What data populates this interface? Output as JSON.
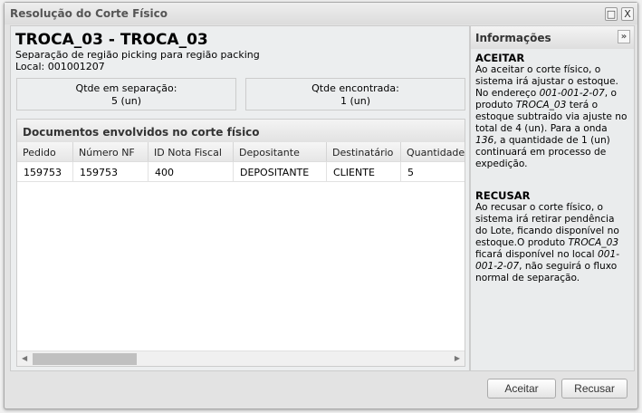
{
  "window": {
    "title": "Resolução do Corte Físico",
    "maximize_icon": "□",
    "close_icon": "X"
  },
  "header": {
    "title": "TROCA_03 - TROCA_03",
    "description": "Separação de região picking para região packing",
    "local": "Local: 001001207"
  },
  "stats": [
    {
      "label": "Qtde em separação:",
      "value": "5 (un)"
    },
    {
      "label": "Qtde encontrada:",
      "value": "1 (un)"
    }
  ],
  "grid": {
    "title": "Documentos envolvidos no corte físico",
    "columns": [
      "Pedido",
      "Número NF",
      "ID Nota Fiscal",
      "Depositante",
      "Destinatário",
      "Quantidade e"
    ],
    "rows": [
      [
        "159753",
        "159753",
        "400",
        "DEPOSITANTE",
        "CLIENTE",
        "5"
      ]
    ]
  },
  "info": {
    "title": "Informações",
    "collapse_icon": "»",
    "accept": {
      "heading": "ACEITAR",
      "segments": [
        {
          "t": "Ao aceitar o corte físico, o sistema irá ajustar o estoque. No endereço "
        },
        {
          "t": "001-001-2-07",
          "i": true
        },
        {
          "t": ", o produto "
        },
        {
          "t": "TROCA_03",
          "i": true
        },
        {
          "t": " terá o estoque subtraido via ajuste no total de 4 (un). Para a onda "
        },
        {
          "t": "136",
          "i": true
        },
        {
          "t": ", a quantidade de 1 (un) continuará em processo de expedição."
        }
      ]
    },
    "refuse": {
      "heading": "RECUSAR",
      "segments": [
        {
          "t": "Ao recusar o corte físico, o sistema irá retirar pendência do Lote, ficando disponível no estoque.O produto "
        },
        {
          "t": "TROCA_03",
          "i": true
        },
        {
          "t": " ficará disponível no local "
        },
        {
          "t": "001-001-2-07",
          "i": true
        },
        {
          "t": ", não seguirá o fluxo normal de separação."
        }
      ]
    }
  },
  "buttons": {
    "accept": "Aceitar",
    "refuse": "Recusar"
  }
}
